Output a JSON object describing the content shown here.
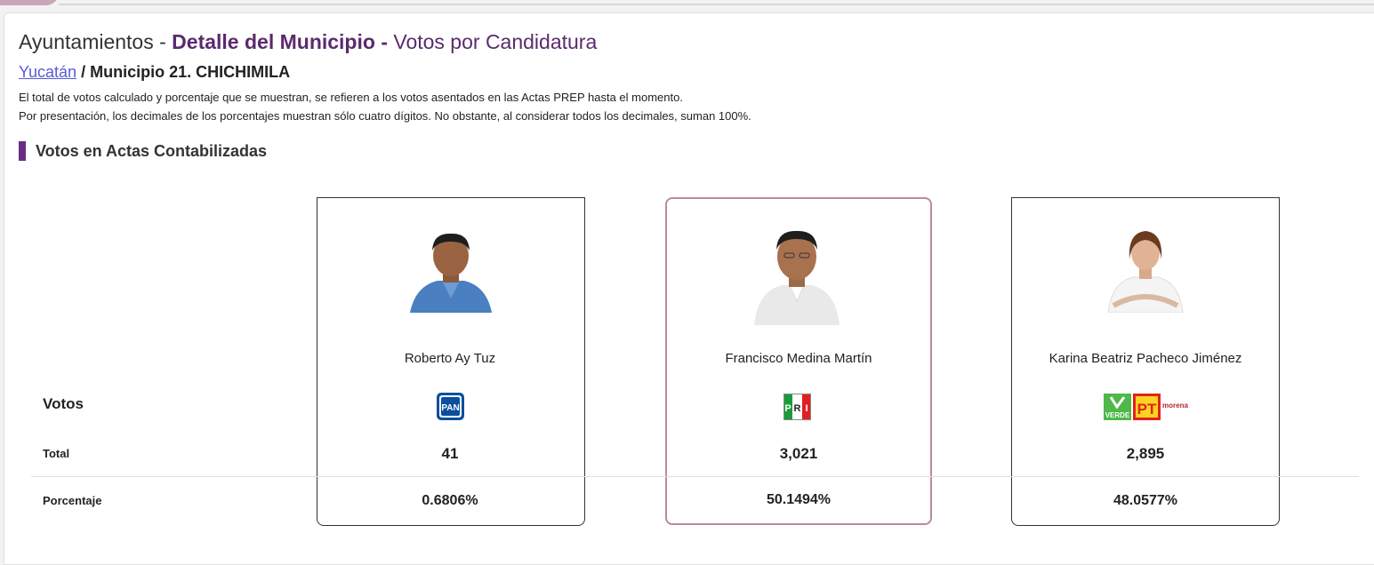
{
  "header": {
    "title_prefix": "Ayuntamientos - ",
    "title_strong": "Detalle del Municipio -",
    "title_suffix": " Votos por Candidatura"
  },
  "breadcrumb": {
    "state": "Yucatán",
    "separator": " / ",
    "municipio": "Municipio 21. CHICHIMILA"
  },
  "notes": [
    "El total de votos calculado y porcentaje que se muestran, se refieren a los votos asentados en las Actas PREP hasta el momento.",
    "Por presentación, los decimales de los porcentajes muestran sólo cuatro dígitos. No obstante, al considerar todos los decimales, suman 100%."
  ],
  "section": {
    "title": "Votos en Actas Contabilizadas"
  },
  "row_labels": {
    "votos": "Votos",
    "total": "Total",
    "porcentaje": "Porcentaje"
  },
  "candidates": [
    {
      "name": "Roberto Ay Tuz",
      "total": "41",
      "percent": "0.6806%",
      "party_icon": "pan-logo",
      "photo_icon": "candidate-photo-man",
      "highlighted": false,
      "shirt_color": "#4a7fc1"
    },
    {
      "name": "Francisco Medina Martín",
      "total": "3,021",
      "percent": "50.1494%",
      "party_icon": "pri-logo",
      "photo_icon": "candidate-photo-man",
      "highlighted": true,
      "shirt_color": "#e9e9e9"
    },
    {
      "name": "Karina Beatriz Pacheco Jiménez",
      "total": "2,895",
      "percent": "48.0577%",
      "party_icon": "verde-pt-morena-logo",
      "photo_icon": "candidate-photo-woman",
      "highlighted": false,
      "shirt_color": "#f4f4f4"
    }
  ],
  "logos": {
    "pan": "PAN",
    "pri": [
      "P",
      "R",
      "I"
    ],
    "verde": "VERDE",
    "pt": "PT",
    "morena": "morena"
  },
  "colors": {
    "accent": "#5b2a6e",
    "section_bar": "#6a2d86",
    "highlight_border": "#b98aa0",
    "link": "#5a5ad6",
    "pan_blue": "#0a4f9e",
    "pri_green": "#1a9c3a",
    "pri_red": "#e02020",
    "verde_green": "#4eb848",
    "pt_red": "#e32219",
    "morena_red": "#b3282d"
  }
}
